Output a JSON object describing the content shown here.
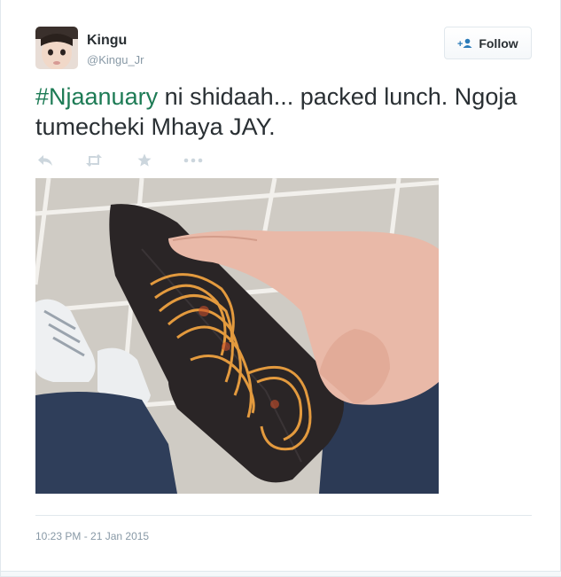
{
  "user": {
    "name": "Kingu",
    "handle": "@Kingu_Jr",
    "avatar_icon": "profile-photo-child"
  },
  "follow_button": {
    "label": "Follow",
    "icon": "add-user-icon"
  },
  "tweet": {
    "hashtag": "#Njaanuary",
    "text_after_hashtag": " ni shidaah... packed lunch. Ngoja tumecheki Mhaya JAY.",
    "timestamp": "10:23 PM - 21 Jan 2015"
  },
  "actions": [
    {
      "name": "reply-icon"
    },
    {
      "name": "retweet-icon"
    },
    {
      "name": "favorite-icon"
    },
    {
      "name": "more-icon"
    }
  ],
  "media": {
    "description_icon": "photo-wallet-with-spaghetti"
  },
  "colors": {
    "hashtag": "#1d7b55",
    "muted": "#8899a6",
    "text": "#292f33",
    "border": "#e1e8ed"
  }
}
